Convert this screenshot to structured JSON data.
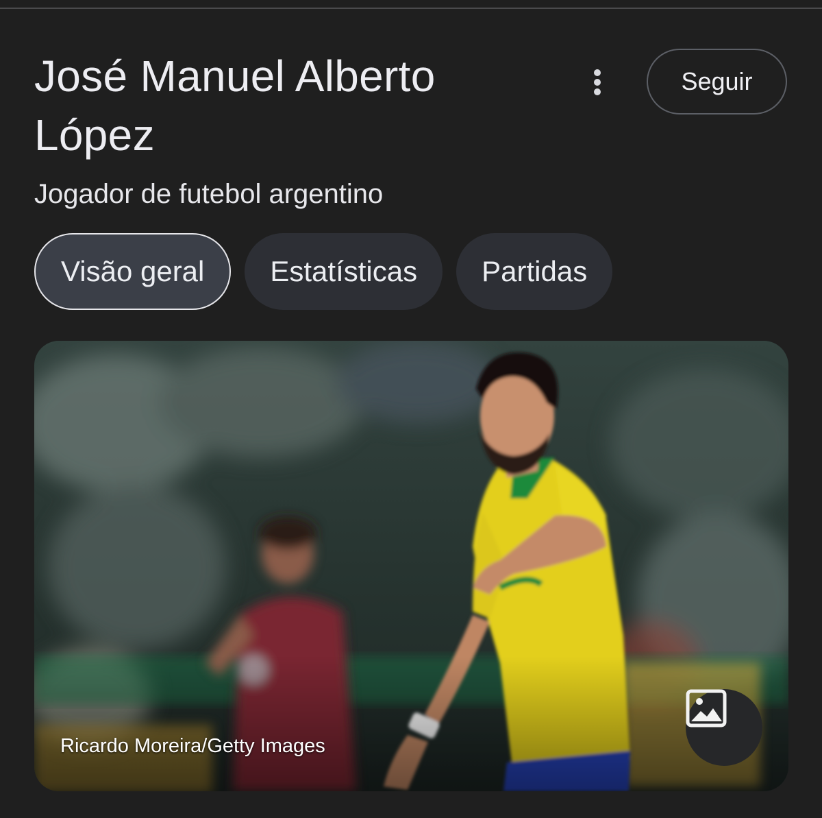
{
  "entity": {
    "title": "José Manuel Alberto López",
    "subtitle": "Jogador de futebol argentino"
  },
  "actions": {
    "more_icon": "vertical-dots-icon",
    "follow_label": "Seguir"
  },
  "tabs": [
    {
      "label": "Visão geral",
      "active": true
    },
    {
      "label": "Estatísticas",
      "active": false
    },
    {
      "label": "Partidas",
      "active": false
    }
  ],
  "hero_image": {
    "credit": "Ricardo Moreira/Getty Images",
    "image_button_icon": "image-icon"
  },
  "colors": {
    "background": "#1f1f1f",
    "text": "#ededf2",
    "tab_background": "#2d2f35",
    "tab_active_background": "#3b3f48",
    "jersey_yellow": "#e6d11a",
    "jersey_green": "#1f8a3a",
    "shorts_blue": "#2643b8"
  }
}
